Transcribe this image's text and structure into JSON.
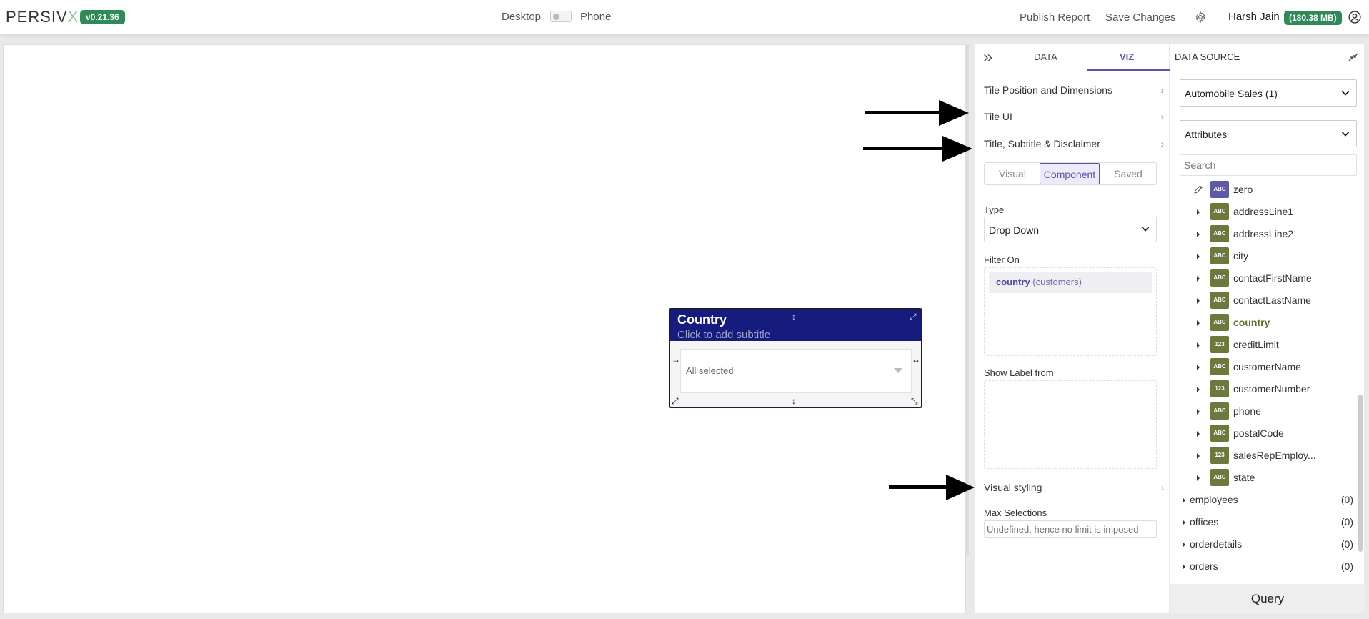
{
  "header": {
    "logo_main": "PERSIV",
    "logo_x": "X",
    "version": "v0.21.36",
    "view_desktop": "Desktop",
    "view_phone": "Phone",
    "publish": "Publish Report",
    "save": "Save Changes",
    "user": "Harsh Jain",
    "memory": "(180.38 MB)"
  },
  "tile": {
    "title": "Country",
    "subtitle": "Click to add subtitle",
    "value": "All selected"
  },
  "viz": {
    "tab_data": "DATA",
    "tab_viz": "VIZ",
    "sections": [
      "Tile Position and Dimensions",
      "Tile UI",
      "Title, Subtitle & Disclaimer"
    ],
    "segments": [
      "Visual",
      "Component",
      "Saved"
    ],
    "type_label": "Type",
    "type_value": "Drop Down",
    "filter_on_label": "Filter On",
    "filter_field": "country",
    "filter_table": "(customers)",
    "show_label_from": "Show Label from",
    "visual_styling": "Visual styling",
    "max_selections_label": "Max Selections",
    "max_selections_placeholder": "Undefined, hence no limit is imposed"
  },
  "datasource": {
    "title": "DATA SOURCE",
    "source": "Automobile Sales (1)",
    "category": "Attributes",
    "search_placeholder": "Search",
    "attributes": [
      {
        "name": "zero",
        "type": "ABC"
      },
      {
        "name": "addressLine1",
        "type": "ABC"
      },
      {
        "name": "addressLine2",
        "type": "ABC"
      },
      {
        "name": "city",
        "type": "ABC"
      },
      {
        "name": "contactFirstName",
        "type": "ABC"
      },
      {
        "name": "contactLastName",
        "type": "ABC"
      },
      {
        "name": "country",
        "type": "ABC"
      },
      {
        "name": "creditLimit",
        "type": "123"
      },
      {
        "name": "customerName",
        "type": "ABC"
      },
      {
        "name": "customerNumber",
        "type": "123"
      },
      {
        "name": "phone",
        "type": "ABC"
      },
      {
        "name": "postalCode",
        "type": "ABC"
      },
      {
        "name": "salesRepEmploy...",
        "type": "123"
      },
      {
        "name": "state",
        "type": "ABC"
      }
    ],
    "tables": [
      {
        "name": "employees",
        "count": "(0)"
      },
      {
        "name": "offices",
        "count": "(0)"
      },
      {
        "name": "orderdetails",
        "count": "(0)"
      },
      {
        "name": "orders",
        "count": "(0)"
      }
    ],
    "query": "Query"
  },
  "colors": {
    "accent": "#5a4fb6",
    "badge_green": "#2e8b57",
    "tile_header": "#151c7d",
    "attr_badge": "#6b7a3c"
  }
}
